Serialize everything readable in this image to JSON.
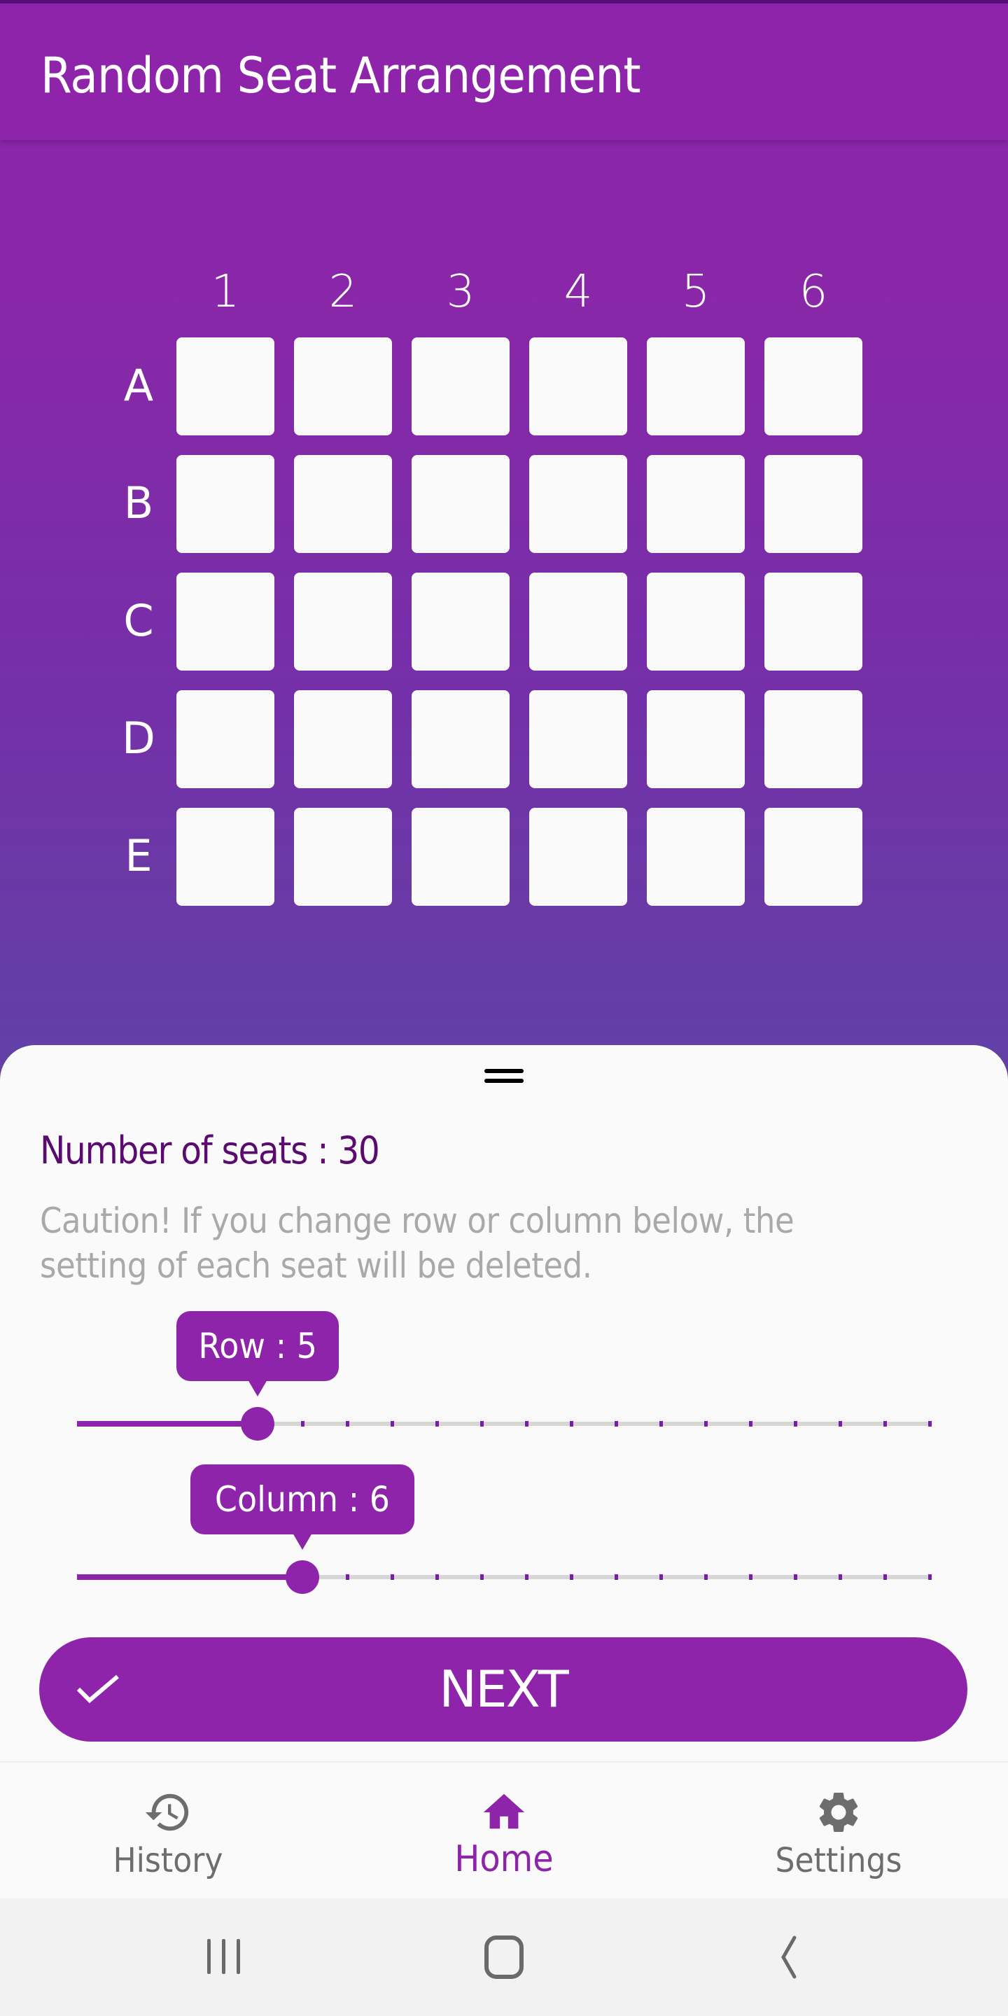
{
  "app_bar": {
    "title": "Random Seat Arrangement"
  },
  "grid": {
    "columns": [
      "1",
      "2",
      "3",
      "4",
      "5",
      "6"
    ],
    "rows": [
      "A",
      "B",
      "C",
      "D",
      "E"
    ],
    "seat_state": "empty"
  },
  "sheet": {
    "seat_count_label": "Number of seats : 30",
    "caution_text": "Caution! If you change row or column below, the setting of each seat will be deleted.",
    "row_slider": {
      "label": "Row : 5",
      "value": 5,
      "min": 1,
      "max": 20
    },
    "column_slider": {
      "label": "Column : 6",
      "value": 6,
      "min": 1,
      "max": 20
    },
    "next_button": {
      "label": "NEXT",
      "icon": "check-icon"
    }
  },
  "bottom_nav": {
    "items": [
      {
        "label": "History",
        "icon": "history-icon",
        "active": false
      },
      {
        "label": "Home",
        "icon": "home-icon",
        "active": true
      },
      {
        "label": "Settings",
        "icon": "gear-icon",
        "active": false
      }
    ]
  },
  "system_nav": {
    "buttons": [
      "recent-apps",
      "home",
      "back"
    ]
  },
  "colors": {
    "primary": "#8e24aa",
    "heading_text": "#5b0a6f",
    "caution_text": "#a9a9a9",
    "inactive_nav": "#6d6d6d",
    "seat": "#fafafa"
  }
}
